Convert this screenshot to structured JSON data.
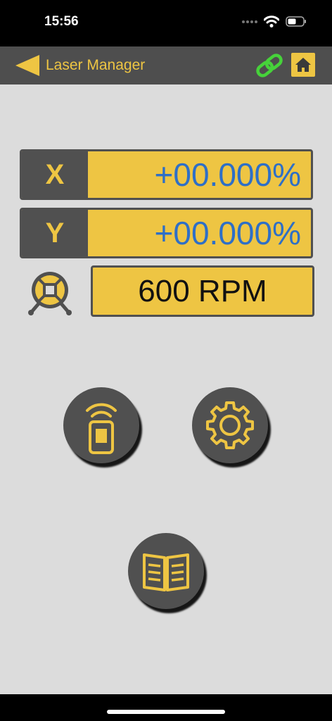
{
  "status_bar": {
    "time": "15:56"
  },
  "nav": {
    "title": "Laser Manager"
  },
  "axes": [
    {
      "label": "X",
      "value": "+00.000%"
    },
    {
      "label": "Y",
      "value": "+00.000%"
    }
  ],
  "rpm": {
    "value": "600 RPM"
  },
  "icons": {
    "back": "back-arrow-icon",
    "link": "link-icon",
    "home": "home-icon",
    "rotation": "rotation-head-icon",
    "remote": "remote-control-icon",
    "settings": "gear-icon",
    "manual": "book-icon"
  },
  "colors": {
    "accent": "#eec543",
    "dark": "#505050",
    "value_blue": "#2e6fc7",
    "link_green": "#46d23a",
    "background": "#dcdcdc"
  }
}
